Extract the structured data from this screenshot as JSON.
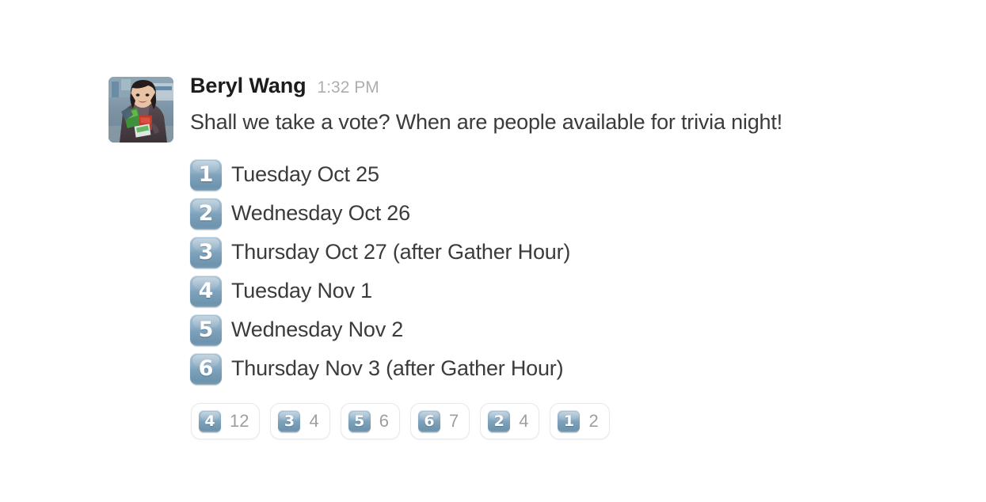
{
  "message": {
    "author": "Beryl Wang",
    "timestamp": "1:32 PM",
    "text": "Shall we take a vote? When are people available for trivia night!",
    "avatar_alt": "Beryl Wang profile photo"
  },
  "options": [
    {
      "keycap": "1",
      "label": "Tuesday Oct 25"
    },
    {
      "keycap": "2",
      "label": "Wednesday Oct 26"
    },
    {
      "keycap": "3",
      "label": "Thursday Oct 27 (after Gather Hour)"
    },
    {
      "keycap": "4",
      "label": "Tuesday Nov 1"
    },
    {
      "keycap": "5",
      "label": "Wednesday Nov 2"
    },
    {
      "keycap": "6",
      "label": "Thursday Nov 3 (after Gather Hour)"
    }
  ],
  "reactions": [
    {
      "keycap": "4",
      "count": "12"
    },
    {
      "keycap": "3",
      "count": "4"
    },
    {
      "keycap": "5",
      "count": "6"
    },
    {
      "keycap": "6",
      "count": "7"
    },
    {
      "keycap": "2",
      "count": "4"
    },
    {
      "keycap": "1",
      "count": "2"
    }
  ],
  "colors": {
    "background": "#ffffff",
    "author_text": "#1d1c1d",
    "timestamp_text": "#aeaeae",
    "body_text": "#3b3b3b",
    "reaction_count_text": "#9e9e9e",
    "keycap_gradient_top": "#a9c2d4",
    "keycap_gradient_bottom": "#6d93ae",
    "pill_border": "#e8e8e8"
  }
}
